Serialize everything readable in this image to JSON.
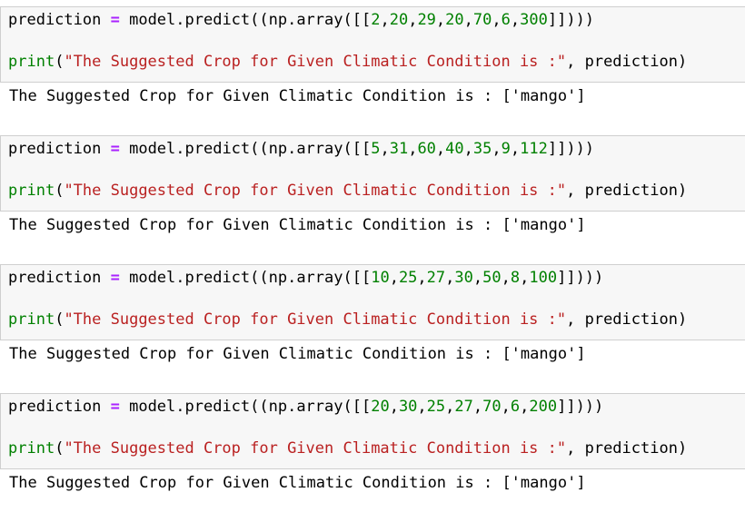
{
  "cells": [
    {
      "code": {
        "var": "prediction",
        "op": "=",
        "call_prefix": " model.predict((np.array([[",
        "values": [
          "2",
          "20",
          "29",
          "20",
          "70",
          "6",
          "300"
        ],
        "call_suffix": "]])))",
        "print_kw": "print",
        "print_open": "(",
        "string": "\"The Suggested Crop for Given Climatic Condition is :\"",
        "print_rest": ", prediction)"
      },
      "output": "The Suggested Crop for Given Climatic Condition is : ['mango']"
    },
    {
      "code": {
        "var": "prediction",
        "op": "=",
        "call_prefix": " model.predict((np.array([[",
        "values": [
          "5",
          "31",
          "60",
          "40",
          "35",
          "9",
          "112"
        ],
        "call_suffix": "]])))",
        "print_kw": "print",
        "print_open": "(",
        "string": "\"The Suggested Crop for Given Climatic Condition is :\"",
        "print_rest": ", prediction)"
      },
      "output": "The Suggested Crop for Given Climatic Condition is : ['mango']"
    },
    {
      "code": {
        "var": "prediction",
        "op": "=",
        "call_prefix": " model.predict((np.array([[",
        "values": [
          "10",
          "25",
          "27",
          "30",
          "50",
          "8",
          "100"
        ],
        "call_suffix": "]])))",
        "print_kw": "print",
        "print_open": "(",
        "string": "\"The Suggested Crop for Given Climatic Condition is :\"",
        "print_rest": ", prediction)"
      },
      "output": "The Suggested Crop for Given Climatic Condition is : ['mango']"
    },
    {
      "code": {
        "var": "prediction",
        "op": "=",
        "call_prefix": " model.predict((np.array([[",
        "values": [
          "20",
          "30",
          "25",
          "27",
          "70",
          "6",
          "200"
        ],
        "call_suffix": "]])))",
        "print_kw": "print",
        "print_open": "(",
        "string": "\"The Suggested Crop for Given Climatic Condition is :\"",
        "print_rest": ", prediction)"
      },
      "output": "The Suggested Crop for Given Climatic Condition is : ['mango']"
    }
  ],
  "colors": {
    "operator": "#aa22ff",
    "number": "#008000",
    "keyword": "#008000",
    "string": "#ba2121",
    "cell_background": "#f7f7f7",
    "cell_border": "#cfcfcf"
  }
}
